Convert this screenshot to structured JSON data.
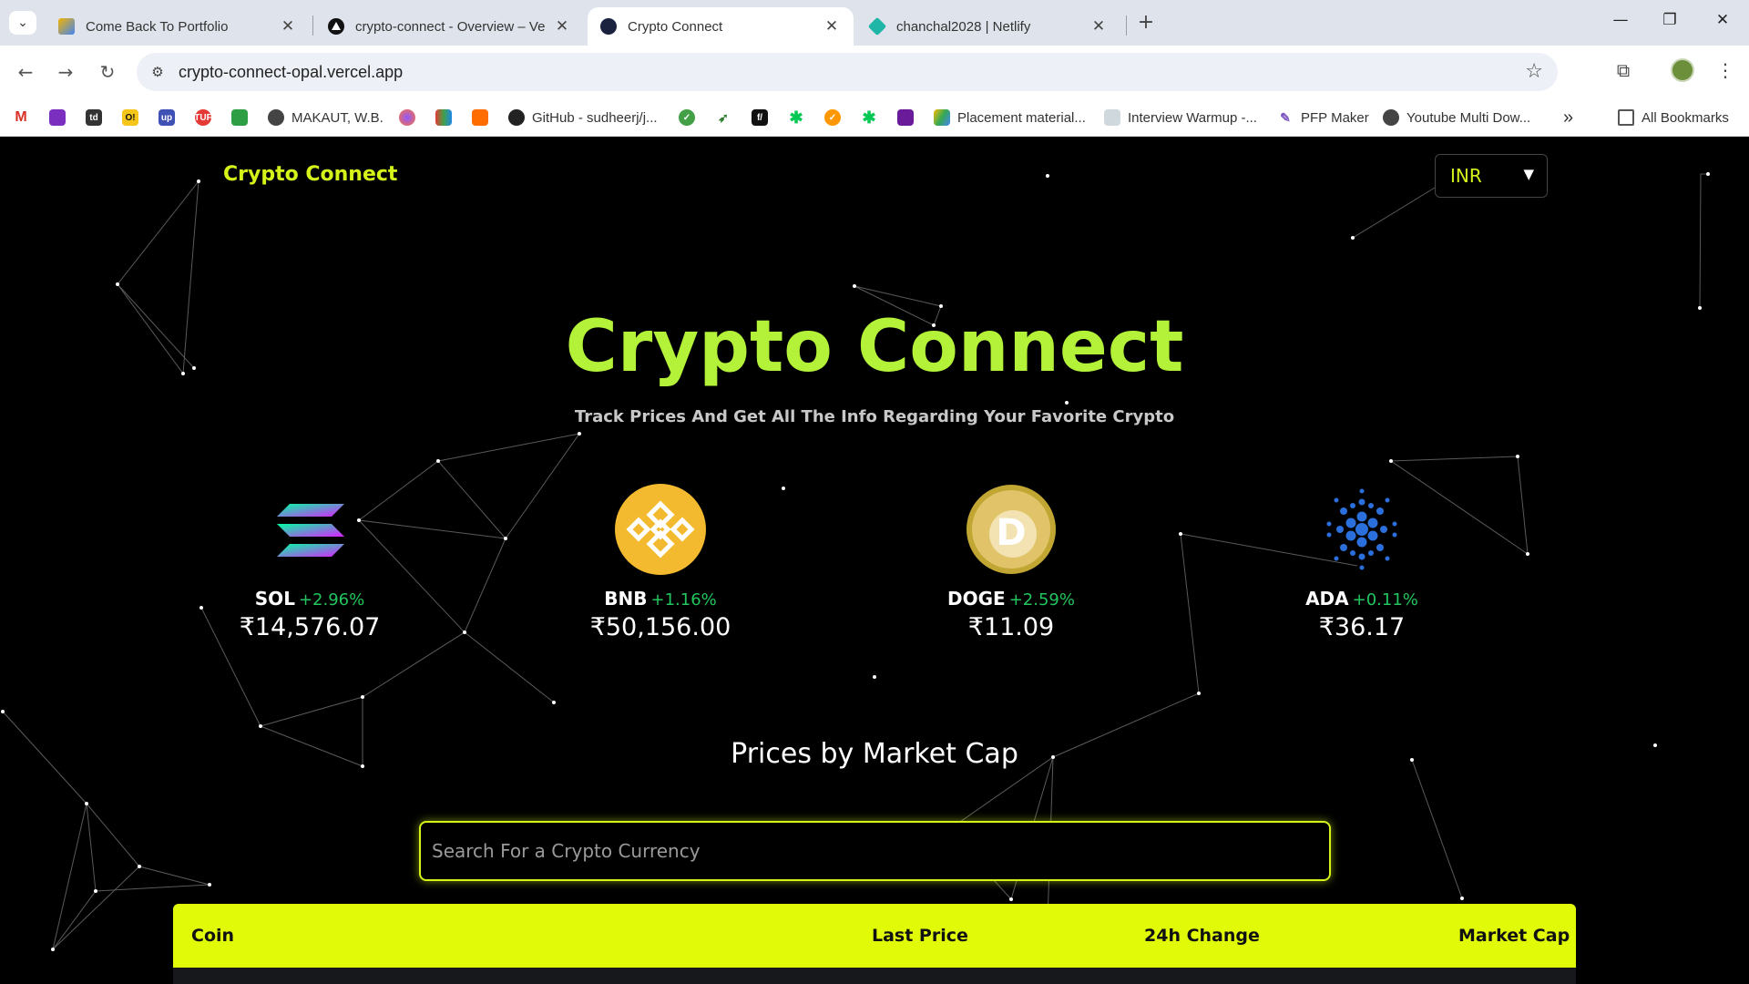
{
  "browser": {
    "tabs": [
      {
        "title": "Come Back To Portfolio",
        "favicon": "portfolio-icon"
      },
      {
        "title": "crypto-connect - Overview – Ve",
        "favicon": "vercel-icon"
      },
      {
        "title": "Crypto Connect",
        "favicon": "crypto-connect-icon",
        "active": true
      },
      {
        "title": "chanchal2028 | Netlify",
        "favicon": "netlify-icon"
      }
    ],
    "url": "crypto-connect-opal.vercel.app",
    "bookmarks": [
      {
        "label": "MAKAUT, W.B."
      },
      {
        "label": "GitHub - sudheerj/j..."
      },
      {
        "label": "Placement material..."
      },
      {
        "label": "Interview Warmup -..."
      },
      {
        "label": "PFP Maker"
      },
      {
        "label": "Youtube Multi Dow..."
      },
      {
        "label": "All Bookmarks"
      }
    ],
    "bookmark_icons": [
      "gmail-icon",
      "slides-icon",
      "td-icon",
      "o-icon",
      "up-icon",
      "tuf-icon",
      "green-icon",
      "globe-icon",
      "firefox-icon",
      "book-icon",
      "chat-icon",
      "github-icon",
      "check-icon",
      "leaf-icon",
      "f-icon",
      "asterisk-icon",
      "check-orange-icon",
      "asterisk-icon",
      "purple-icon",
      "drive-icon",
      "warmup-icon",
      "pfp-icon",
      "globe-icon",
      "chevron-double-right-icon",
      "folder-icon"
    ]
  },
  "page": {
    "brand": "Crypto Connect",
    "currency": "INR",
    "hero_title": "Crypto Connect",
    "hero_subtitle": "Track Prices And Get All The Info Regarding Your Favorite Crypto",
    "coins": [
      {
        "symbol": "SOL",
        "change": "+2.96%",
        "price": "₹14,576.07",
        "logo": "solana-icon"
      },
      {
        "symbol": "BNB",
        "change": "+1.16%",
        "price": "₹50,156.00",
        "logo": "bnb-icon"
      },
      {
        "symbol": "DOGE",
        "change": "+2.59%",
        "price": "₹11.09",
        "logo": "dogecoin-icon"
      },
      {
        "symbol": "ADA",
        "change": "+0.11%",
        "price": "₹36.17",
        "logo": "cardano-icon"
      }
    ],
    "section_title": "Prices by Market Cap",
    "search_placeholder": "Search For a Crypto Currency",
    "table_headers": {
      "coin": "Coin",
      "last_price": "Last Price",
      "change_24h": "24h Change",
      "market_cap": "Market Cap"
    }
  },
  "colors": {
    "accent": "#e0fa08",
    "brand_text": "#d6f319",
    "positive": "#22c55e",
    "background": "#000000"
  }
}
